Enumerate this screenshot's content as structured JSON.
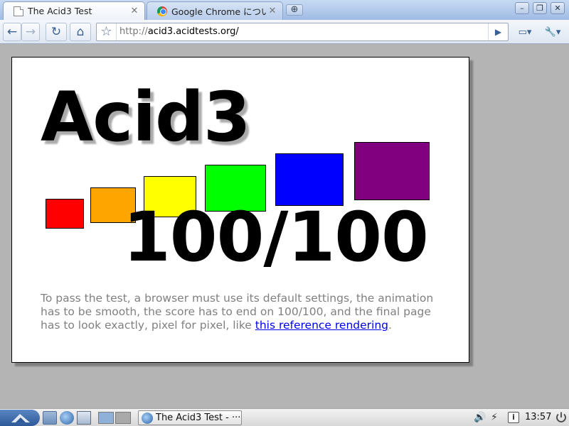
{
  "window": {
    "tabs": [
      {
        "title": "The Acid3 Test",
        "icon": "page-icon",
        "active": true
      },
      {
        "title": "Google Chrome について",
        "icon": "chrome-icon",
        "active": false
      }
    ],
    "new_tab_symbol": "⊕",
    "controls": {
      "minimize": "–",
      "maximize": "❐",
      "close": "✕"
    }
  },
  "toolbar": {
    "back": "←",
    "forward": "→",
    "reload": "↻",
    "home": "⌂",
    "star": "☆",
    "url_scheme": "http://",
    "url_host": "acid3.acidtests.org/",
    "go": "▶",
    "page_menu": "▭▾",
    "tools_menu": "🔧▾"
  },
  "page": {
    "title": "Acid3",
    "score": "100/100",
    "buckets": [
      {
        "color": "#ff0000"
      },
      {
        "color": "#ffa500"
      },
      {
        "color": "#ffff00"
      },
      {
        "color": "#00ff00"
      },
      {
        "color": "#0000ff"
      },
      {
        "color": "#800080"
      }
    ],
    "instructions_text": "To pass the test, a browser must use its default settings, the animation has to be smooth, the score has to end on 100/100, and the final page has to look exactly, pixel for pixel, like ",
    "reference_link": "this reference rendering",
    "instructions_end": "."
  },
  "taskbar": {
    "task_title": "The Acid3 Test - ···",
    "volume": "🔊",
    "network": "⚡",
    "info": "i",
    "clock": "13:57"
  }
}
